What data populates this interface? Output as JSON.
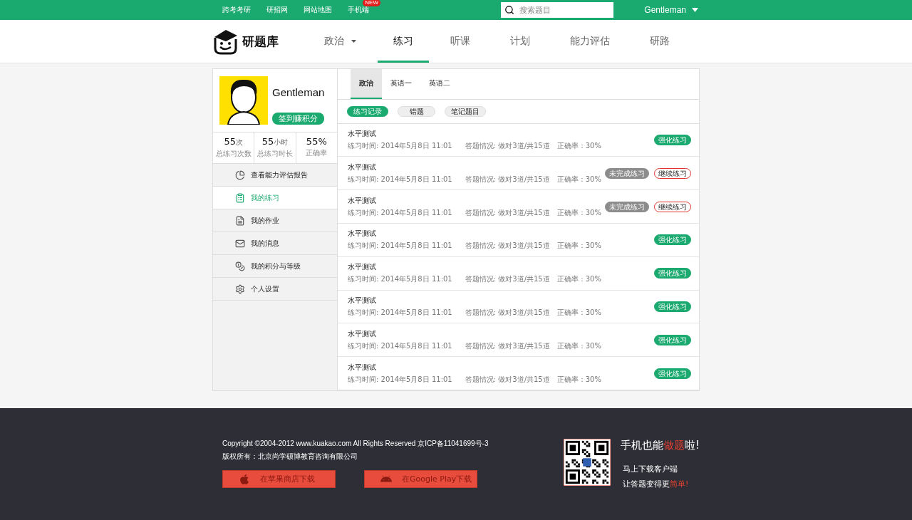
{
  "top_bar": {
    "links": [
      {
        "label": "跨考考研"
      },
      {
        "label": "研招网"
      },
      {
        "label": "网站地图"
      },
      {
        "label": "手机端",
        "badge": "NEW"
      }
    ],
    "search": {
      "placeholder": "搜索题目"
    },
    "user": "Gentleman"
  },
  "header": {
    "logo": "研题库",
    "nav": [
      {
        "label": "政治",
        "dropdown": true,
        "selected": false
      },
      {
        "label": "练习",
        "dropdown": false,
        "selected": true
      },
      {
        "label": "听课",
        "dropdown": false,
        "selected": false
      },
      {
        "label": "计划",
        "dropdown": false,
        "selected": false
      },
      {
        "label": "能力评估",
        "dropdown": false,
        "selected": false
      },
      {
        "label": "研路",
        "dropdown": false,
        "selected": false
      }
    ]
  },
  "profile": {
    "name": "Gentleman",
    "checkin": "签到赚积分",
    "stats": [
      {
        "value": "55",
        "unit": "次",
        "label": "总练习次数"
      },
      {
        "value": "55",
        "unit": "小时",
        "label": "总练习时长"
      },
      {
        "value": "55%",
        "label": "正确率"
      }
    ]
  },
  "sidebar": {
    "items": [
      {
        "label": "查看能力评估报告",
        "kind": "report",
        "selected": false
      },
      {
        "label": "我的练习",
        "kind": "practice",
        "selected": true
      },
      {
        "label": "我的作业",
        "kind": "homework",
        "selected": false
      },
      {
        "label": "我的消息",
        "kind": "message",
        "selected": false
      },
      {
        "label": "我的积分与等级",
        "kind": "points",
        "selected": false
      },
      {
        "label": "个人设置",
        "kind": "settings",
        "selected": false
      }
    ]
  },
  "subject_tabs": [
    {
      "label": "政治",
      "selected": true
    },
    {
      "label": "英语一",
      "selected": false
    },
    {
      "label": "英语二",
      "selected": false
    }
  ],
  "filters": [
    {
      "label": "练习记录",
      "selected": true
    },
    {
      "label": "错题",
      "selected": false
    },
    {
      "label": "笔记题目",
      "selected": false
    }
  ],
  "records": [
    {
      "title": "水平测试",
      "time": "练习时间: 2014年5月8日 11:01",
      "result": "答题情况: 做对3道/共15道",
      "accuracy": "正确率：30%",
      "actions": [
        {
          "label": "强化练习",
          "kind": "primary"
        }
      ]
    },
    {
      "title": "水平测试",
      "time": "练习时间: 2014年5月8日 11:01",
      "result": "答题情况: 做对3道/共15道",
      "accuracy": "正确率：30%",
      "actions": [
        {
          "label": "未完成练习",
          "kind": "status"
        },
        {
          "label": "继续练习",
          "kind": "outline"
        }
      ]
    },
    {
      "title": "水平测试",
      "time": "练习时间: 2014年5月8日 11:01",
      "result": "答题情况: 做对3道/共15道",
      "accuracy": "正确率：30%",
      "actions": [
        {
          "label": "未完成练习",
          "kind": "status"
        },
        {
          "label": "继续练习",
          "kind": "outline"
        }
      ]
    },
    {
      "title": "水平测试",
      "time": "练习时间: 2014年5月8日 11:01",
      "result": "答题情况: 做对3道/共15道",
      "accuracy": "正确率：30%",
      "actions": [
        {
          "label": "强化练习",
          "kind": "primary"
        }
      ]
    },
    {
      "title": "水平测试",
      "time": "练习时间: 2014年5月8日 11:01",
      "result": "答题情况: 做对3道/共15道",
      "accuracy": "正确率：30%",
      "actions": [
        {
          "label": "强化练习",
          "kind": "primary"
        }
      ]
    },
    {
      "title": "水平测试",
      "time": "练习时间: 2014年5月8日 11:01",
      "result": "答题情况: 做对3道/共15道",
      "accuracy": "正确率：30%",
      "actions": [
        {
          "label": "强化练习",
          "kind": "primary"
        }
      ]
    },
    {
      "title": "水平测试",
      "time": "练习时间: 2014年5月8日 11:01",
      "result": "答题情况: 做对3道/共15道",
      "accuracy": "正确率：30%",
      "actions": [
        {
          "label": "强化练习",
          "kind": "primary"
        }
      ]
    },
    {
      "title": "水平测试",
      "time": "练习时间: 2014年5月8日 11:01",
      "result": "答题情况: 做对3道/共15道",
      "accuracy": "正确率：30%",
      "actions": [
        {
          "label": "强化练习",
          "kind": "primary"
        }
      ]
    }
  ],
  "footer": {
    "copyright": "Copyright ©2004-2012 www.kuakao.com All Rights Reserved 京ICP备11041699号-3",
    "owner": "版权所有：北京尚学硕博教育咨询有限公司",
    "downloads": [
      {
        "label": "在苹果商店下载",
        "kind": "apple"
      },
      {
        "label": "在Google Play下载",
        "kind": "android"
      }
    ],
    "slogan": [
      {
        "text": "手机也能",
        "highlight": false
      },
      {
        "text": "做题",
        "highlight": true
      },
      {
        "text": "啦!",
        "highlight": false
      }
    ],
    "tagline_1": [
      {
        "text": "马上下载客户端",
        "highlight": false
      }
    ],
    "tagline_2": [
      {
        "text": "让答题变得更",
        "highlight": false
      },
      {
        "text": "简单!",
        "highlight": true
      }
    ]
  }
}
